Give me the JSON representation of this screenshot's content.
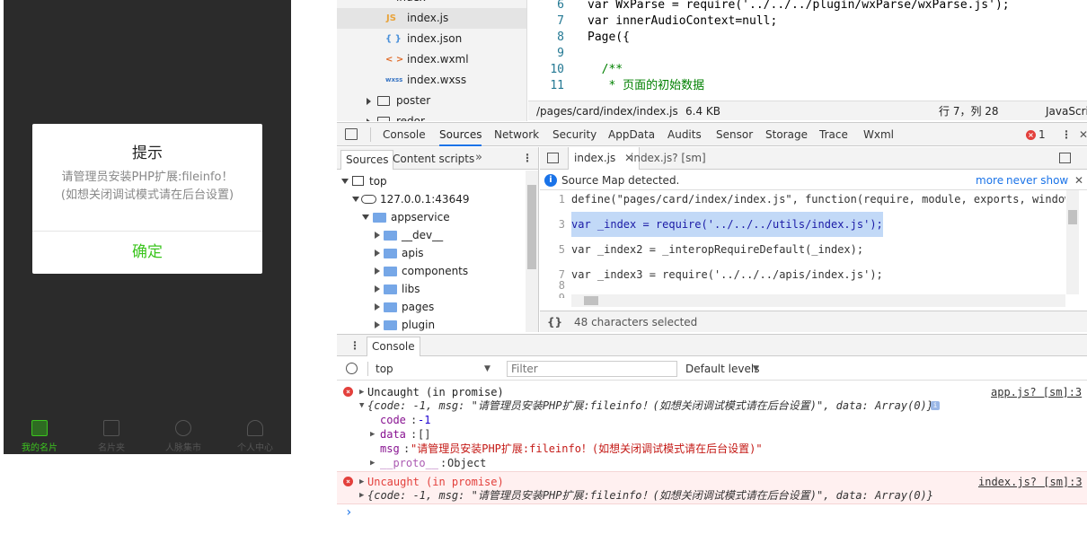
{
  "simulator": {
    "dialog": {
      "title": "提示",
      "message": "请管理员安装PHP扩展:fileinfo！(如想关闭调试模式请在后台设置)",
      "confirm_label": "确定"
    },
    "tabbar": [
      {
        "label": "我的名片",
        "icon": "card-icon",
        "active": true
      },
      {
        "label": "名片夹",
        "icon": "folder-r-icon",
        "active": false
      },
      {
        "label": "人脉集市",
        "icon": "people-icon",
        "active": false
      },
      {
        "label": "个人中心",
        "icon": "user-icon",
        "active": false
      }
    ]
  },
  "file_tree": {
    "top_item": "index",
    "items": [
      {
        "icon_text": "JS",
        "name": "index.js",
        "color": "#e8a33a"
      },
      {
        "icon_text": "{ }",
        "name": "index.json",
        "color": "#4a90d9"
      },
      {
        "icon_text": "< >",
        "name": "index.wxml",
        "color": "#e06c2a"
      },
      {
        "icon_text": "wxss",
        "name": "index.wxss",
        "color": "#3a76c4"
      }
    ],
    "folders": [
      "poster",
      "redor"
    ]
  },
  "code_editor": {
    "lines": [
      {
        "n": "6",
        "code": "var WxParse = require('../../../plugin/wxParse/wxParse.js');"
      },
      {
        "n": "7",
        "code": "var innerAudioContext=null;"
      },
      {
        "n": "8",
        "code": "Page({"
      },
      {
        "n": "9",
        "code": ""
      },
      {
        "n": "10",
        "code": "  /**"
      },
      {
        "n": "11",
        "code": "   * 页面的初始数据"
      }
    ],
    "status": {
      "path": "/pages/card/index/index.js",
      "size": "6.4 KB",
      "position": "行 7，列 28",
      "language": "JavaScri"
    }
  },
  "devtools": {
    "tabs": [
      "Console",
      "Sources",
      "Network",
      "Security",
      "AppData",
      "Audits",
      "Sensor",
      "Storage",
      "Trace",
      "Wxml"
    ],
    "active_tab": "Sources",
    "error_count": "1",
    "nav_tabs": [
      "Sources",
      "Content scripts"
    ],
    "tree": {
      "root": "top",
      "host": "127.0.0.1:43649",
      "folder": "appservice",
      "children": [
        "__dev__",
        "apis",
        "components",
        "libs",
        "pages",
        "plugin"
      ]
    },
    "editor_tabs": [
      "index.js",
      "index.js? [sm]"
    ],
    "source_map_msg": "Source Map detected.",
    "source_map_more": "more",
    "source_map_never": "never show",
    "lines": [
      {
        "n": "1",
        "code": "define(\"pages/card/index/index.js\", function(require, module, exports, window,d"
      },
      {
        "n": "3",
        "code": "var _index = require('../../../utils/index.js');"
      },
      {
        "n": "5",
        "code": "var _index2 = _interopRequireDefault(_index);"
      },
      {
        "n": "7",
        "code": "var _index3 = require('../../../apis/index.js');"
      },
      {
        "n": "8",
        "code": ""
      },
      {
        "n": "9",
        "code": ""
      }
    ],
    "selection_status": "48 characters selected",
    "format_icon_text": "{}"
  },
  "console": {
    "drawer_tab": "Console",
    "context": "top",
    "filter_placeholder": "Filter",
    "levels": "Default levels",
    "entries": [
      {
        "title": "Uncaught (in promise)",
        "source": "app.js? [sm]:3",
        "summary": "{code: -1, msg: \"请管理员安装PHP扩展:fileinfo！(如想关闭调试模式请在后台设置)\", data: Array(0)}",
        "props": [
          {
            "k": "code",
            "v": "-1"
          },
          {
            "k": "data",
            "v": "[]"
          },
          {
            "k": "msg",
            "v": "\"请管理员安装PHP扩展:fileinfo！(如想关闭调试模式请在后台设置)\""
          },
          {
            "k": "__proto__",
            "v": "Object"
          }
        ]
      },
      {
        "title": "Uncaught (in promise)",
        "source": "index.js? [sm]:3",
        "summary": "{code: -1, msg: \"请管理员安装PHP扩展:fileinfo！(如想关闭调试模式请在后台设置)\", data: Array(0)}"
      }
    ],
    "prompt": "›"
  }
}
